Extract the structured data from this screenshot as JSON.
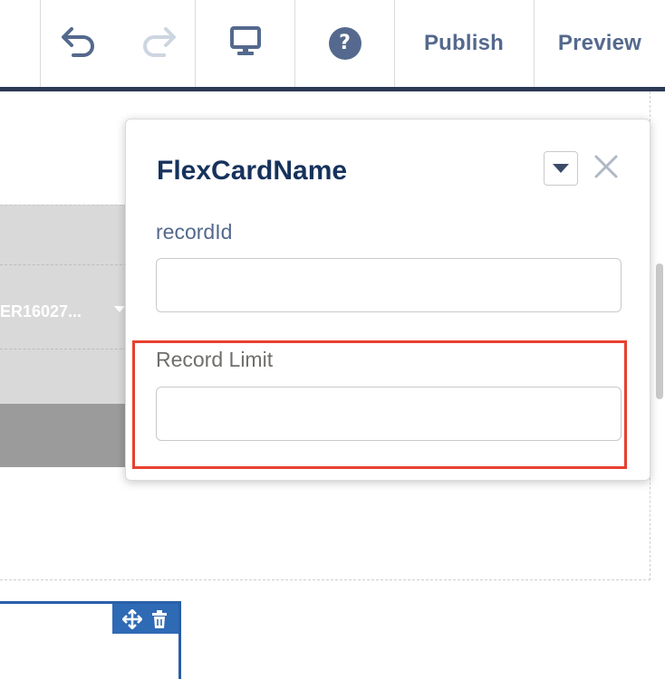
{
  "toolbar": {
    "undo_icon": "undo-icon",
    "redo_icon": "redo-icon",
    "preview_device_icon": "desktop-icon",
    "help_icon": "help-icon",
    "help_glyph": "?",
    "publish_label": "Publish",
    "preview_label": "Preview"
  },
  "canvas": {
    "card_text": "ER16027..."
  },
  "popover": {
    "title": "FlexCardName",
    "fields": [
      {
        "label": "recordId",
        "value": "",
        "placeholder": ""
      },
      {
        "label": "Record Limit",
        "value": "",
        "placeholder": ""
      }
    ]
  },
  "colors": {
    "toolbar_text": "#54698d",
    "toolbar_border": "#2b3a55",
    "popover_title": "#16325c",
    "highlight": "#e8402f",
    "selection": "#2f6ab5"
  }
}
